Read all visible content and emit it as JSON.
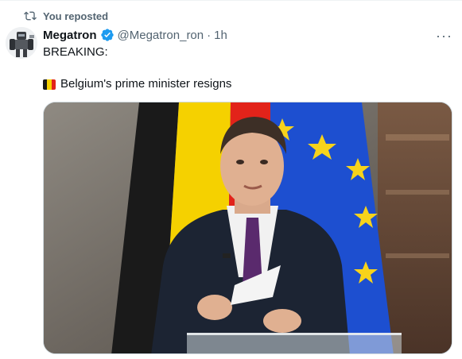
{
  "repost": {
    "label": "You reposted",
    "icon": "repost-icon"
  },
  "author": {
    "name": "Megatron",
    "handle": "@Megatron_ron",
    "separator": "·",
    "time": "1h",
    "verified": true,
    "avatar_icon": "robot-avatar"
  },
  "more_label": "···",
  "tweet": {
    "line1": "BREAKING:",
    "line2_flag": "belgium-flag-icon",
    "line2_text": "Belgium's prime minister resigns"
  },
  "media": {
    "description_icon": "press-photo",
    "colors": {
      "flag_black": "#1a1a1a",
      "flag_yellow": "#f5d100",
      "flag_red": "#e2231a",
      "eu_blue": "#1d4fd0",
      "eu_star": "#f7d31b",
      "suit": "#1c2433",
      "tie": "#5a2a6d"
    }
  },
  "colors": {
    "verified": "#1d9bf0",
    "muted": "#536471",
    "text": "#0f1419"
  }
}
